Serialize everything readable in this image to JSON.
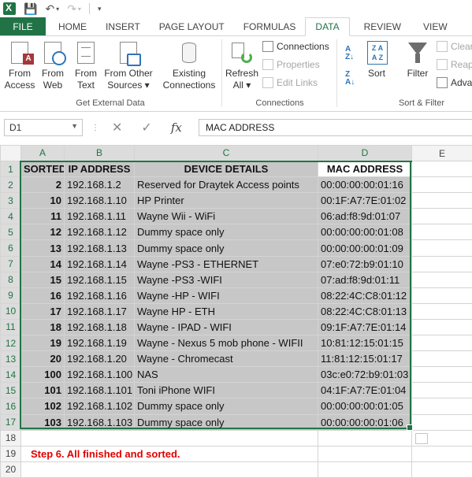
{
  "ribbon_tabs": [
    "FILE",
    "HOME",
    "INSERT",
    "PAGE LAYOUT",
    "FORMULAS",
    "DATA",
    "REVIEW",
    "VIEW"
  ],
  "ribbon": {
    "from_access": [
      "From",
      "Access"
    ],
    "from_web": [
      "From",
      "Web"
    ],
    "from_text": [
      "From",
      "Text"
    ],
    "from_other": [
      "From Other",
      "Sources ▾"
    ],
    "existing": [
      "Existing",
      "Connections"
    ],
    "get_external_label": "Get External Data",
    "refresh": [
      "Refresh",
      "All ▾"
    ],
    "connections": "Connections",
    "properties": "Properties",
    "edit_links": "Edit Links",
    "connections_label": "Connections",
    "sort": "Sort",
    "filter": "Filter",
    "clear": "Clear",
    "reapply": "Reap",
    "advanced": "Adva",
    "sort_filter_label": "Sort & Filter"
  },
  "formula_bar": {
    "name_box": "D1",
    "formula": "MAC ADDRESS"
  },
  "columns": [
    "A",
    "B",
    "C",
    "D",
    "E"
  ],
  "rows": [
    {
      "n": "1",
      "a": "SORTED",
      "b": "IP ADDRESS",
      "c": "DEVICE DETAILS",
      "d": "MAC ADDRESS"
    },
    {
      "n": "2",
      "a": "2",
      "b": "192.168.1.2",
      "c": "Reserved for Draytek Access points",
      "d": "00:00:00:00:01:16"
    },
    {
      "n": "3",
      "a": "10",
      "b": "192.168.1.10",
      "c": "HP  Printer",
      "d": "00:1F:A7:7E:01:02"
    },
    {
      "n": "4",
      "a": "11",
      "b": "192.168.1.11",
      "c": "Wayne Wii - WiFi",
      "d": "06:ad:f8:9d:01:07"
    },
    {
      "n": "5",
      "a": "12",
      "b": "192.168.1.12",
      "c": "Dummy space only",
      "d": "00:00:00:00:01:08"
    },
    {
      "n": "6",
      "a": "13",
      "b": "192.168.1.13",
      "c": "Dummy space only",
      "d": "00:00:00:00:01:09"
    },
    {
      "n": "7",
      "a": "14",
      "b": "192.168.1.14",
      "c": "Wayne -PS3 - ETHERNET",
      "d": "07:e0:72:b9:01:10"
    },
    {
      "n": "8",
      "a": "15",
      "b": "192.168.1.15",
      "c": "Wayne -PS3 -WIFI",
      "d": "07:ad:f8:9d:01:11"
    },
    {
      "n": "9",
      "a": "16",
      "b": "192.168.1.16",
      "c": "Wayne -HP - WIFI",
      "d": "08:22:4C:C8:01:12"
    },
    {
      "n": "10",
      "a": "17",
      "b": "192.168.1.17",
      "c": "Wayne  HP - ETH",
      "d": "08:22:4C:C8:01:13"
    },
    {
      "n": "11",
      "a": "18",
      "b": "192.168.1.18",
      "c": "Wayne  - IPAD - WIFI",
      "d": "09:1F:A7:7E:01:14"
    },
    {
      "n": "12",
      "a": "19",
      "b": "192.168.1.19",
      "c": "Wayne - Nexus 5 mob phone - WIFII",
      "d": "10:81:12:15:01:15"
    },
    {
      "n": "13",
      "a": "20",
      "b": "192.168.1.20",
      "c": "Wayne - Chromecast",
      "d": "11:81:12:15:01:17"
    },
    {
      "n": "14",
      "a": "100",
      "b": "192.168.1.100",
      "c": "NAS",
      "d": "03c:e0:72:b9:01:03"
    },
    {
      "n": "15",
      "a": "101",
      "b": "192.168.1.101",
      "c": "Toni iPhone WIFI",
      "d": "04:1F:A7:7E:01:04"
    },
    {
      "n": "16",
      "a": "102",
      "b": "192.168.1.102",
      "c": "Dummy space only",
      "d": "00:00:00:00:01:05"
    },
    {
      "n": "17",
      "a": "103",
      "b": "192.168.1.103",
      "c": "Dummy space only",
      "d": "00:00:00:00:01:06"
    }
  ],
  "extra_rows": [
    {
      "n": "18",
      "note": ""
    },
    {
      "n": "19",
      "note": "Step 6. All finished and sorted."
    },
    {
      "n": "20",
      "note": ""
    }
  ],
  "colors": {
    "accent": "#217346",
    "note": "#e00000",
    "selection_fill": "#c7c7c7"
  }
}
